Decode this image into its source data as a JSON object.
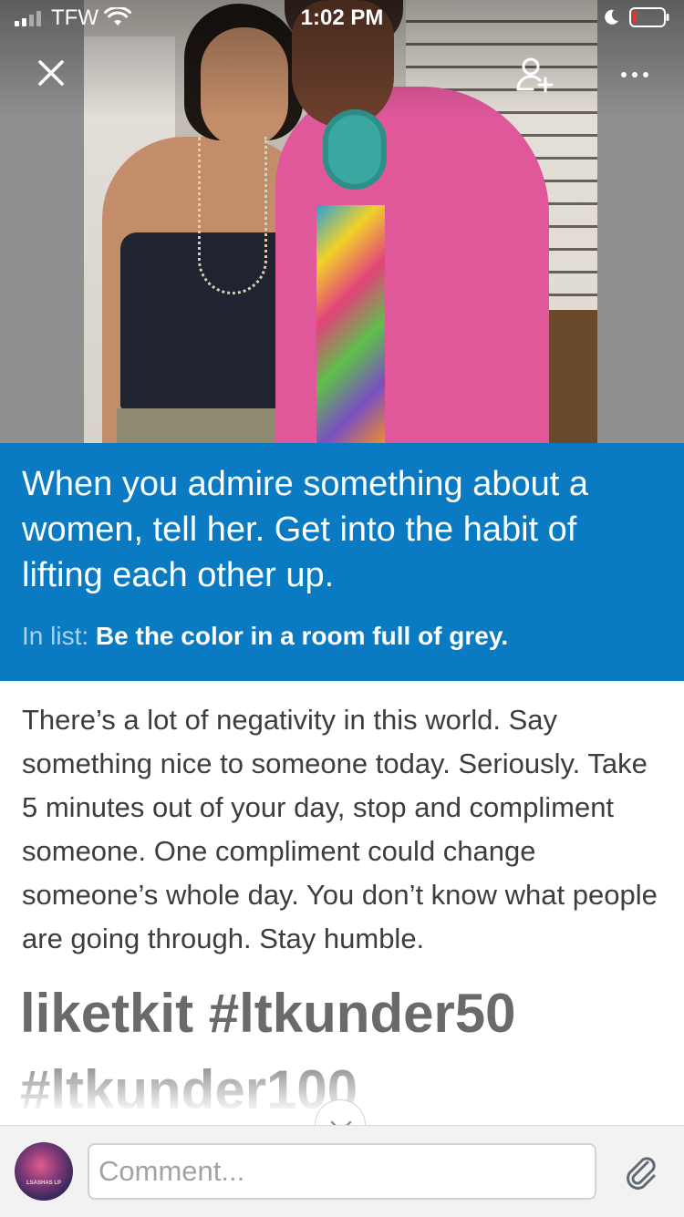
{
  "status_bar": {
    "carrier": "TFW",
    "time": "1:02 PM",
    "signal_bars_active": 2,
    "signal_bars_total": 4,
    "battery_level": 0.1
  },
  "nav": {
    "close_icon": "close-icon",
    "add_person_icon": "add-person-icon",
    "more_icon": "more-icon"
  },
  "post": {
    "title": "When you admire something about a women, tell her. Get into the habit of lifting each other up.",
    "list_prefix": "In list:",
    "list_name": "Be the color in a room full of grey.",
    "body": "There’s a lot of negativity in this world. Say something nice to someone today. Seriously. Take 5 minutes out of your day, stop and compliment someone. One compliment could change someone’s whole day. You don’t know what people are going through. Stay humble.",
    "hashtags": "liketkit #ltkunder50 #ltkunder100"
  },
  "comment": {
    "placeholder": "Comment...",
    "avatar_label": "LSASHAS LP"
  },
  "colors": {
    "accent_blue": "#0a7bc2",
    "list_prefix": "#a9d3f0",
    "cardigan_pink": "#e0579a",
    "battery_red": "#e8332b"
  }
}
